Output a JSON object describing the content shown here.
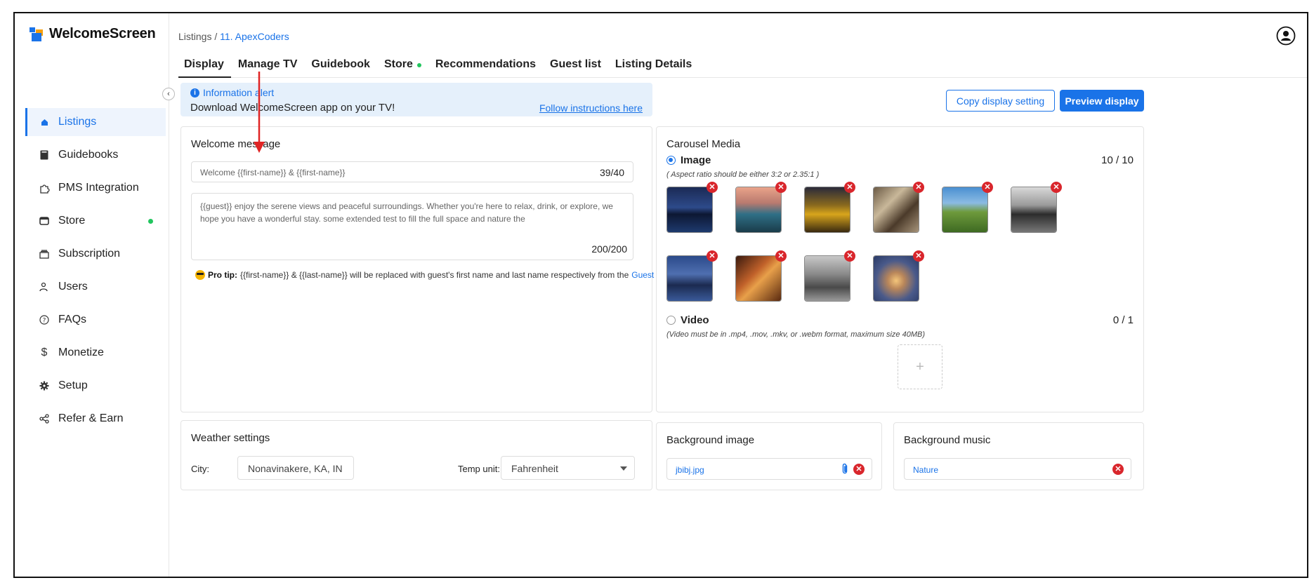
{
  "app": {
    "logo_text": "WelcomeScreen"
  },
  "breadcrumb": {
    "root": "Listings",
    "separator": " / ",
    "current": "11. ApexCoders"
  },
  "sidebar": {
    "items": [
      {
        "label": "Listings",
        "icon": "home-icon"
      },
      {
        "label": "Guidebooks",
        "icon": "book-icon"
      },
      {
        "label": "PMS Integration",
        "icon": "puzzle-icon"
      },
      {
        "label": "Store",
        "icon": "store-icon"
      },
      {
        "label": "Subscription",
        "icon": "subscription-icon"
      },
      {
        "label": "Users",
        "icon": "users-icon"
      },
      {
        "label": "FAQs",
        "icon": "faq-icon"
      },
      {
        "label": "Monetize",
        "icon": "dollar-icon"
      },
      {
        "label": "Setup",
        "icon": "gear-icon"
      },
      {
        "label": "Refer & Earn",
        "icon": "share-icon"
      }
    ]
  },
  "tabs": [
    "Display",
    "Manage TV",
    "Guidebook",
    "Store",
    "Recommendations",
    "Guest list",
    "Listing Details"
  ],
  "alert": {
    "title": "Information alert",
    "text": "Download WelcomeScreen app on your TV!",
    "link": "Follow instructions here"
  },
  "actions": {
    "copy": "Copy display setting",
    "preview": "Preview display"
  },
  "welcome": {
    "title": "Welcome message",
    "subject_value": "Welcome {{first-name}} & {{first-name}}",
    "subject_count": "39/40",
    "body_value": "{{guest}} enjoy the serene views and peaceful surroundings. Whether you're here to relax, drink, or explore, we hope you have a wonderful stay. some extended test to fill the full space and nature the",
    "body_count": "200/200",
    "pro_tip_label": "Pro tip:",
    "pro_tip_text": "{{first-name}} & {{last-name}} will be replaced with guest's first name and last name respectively from the",
    "pro_tip_link": "Guest List"
  },
  "carousel": {
    "title": "Carousel Media",
    "image_label": "Image",
    "image_count": "10 / 10",
    "image_hint": "( Aspect ratio should be either 3:2 or 2.35:1 )",
    "video_label": "Video",
    "video_count": "0 / 1",
    "video_hint": "(Video must be in .mp4, .mov, .mkv, or .webm format, maximum size 40MB)",
    "upload_icon": "+",
    "remove_glyph": "✕"
  },
  "weather": {
    "title": "Weather settings",
    "city_label": "City:",
    "city_value": "Nonavinakere, KA, IN",
    "temp_label": "Temp unit:",
    "temp_value": "Fahrenheit"
  },
  "background_image": {
    "title": "Background image",
    "file": "jbibj.jpg"
  },
  "background_music": {
    "title": "Background music",
    "value": "Nature"
  },
  "colors": {
    "accent": "#1a73e8",
    "danger": "#d9262c",
    "success": "#22c55e",
    "annotation_arrow": "#e02424"
  }
}
